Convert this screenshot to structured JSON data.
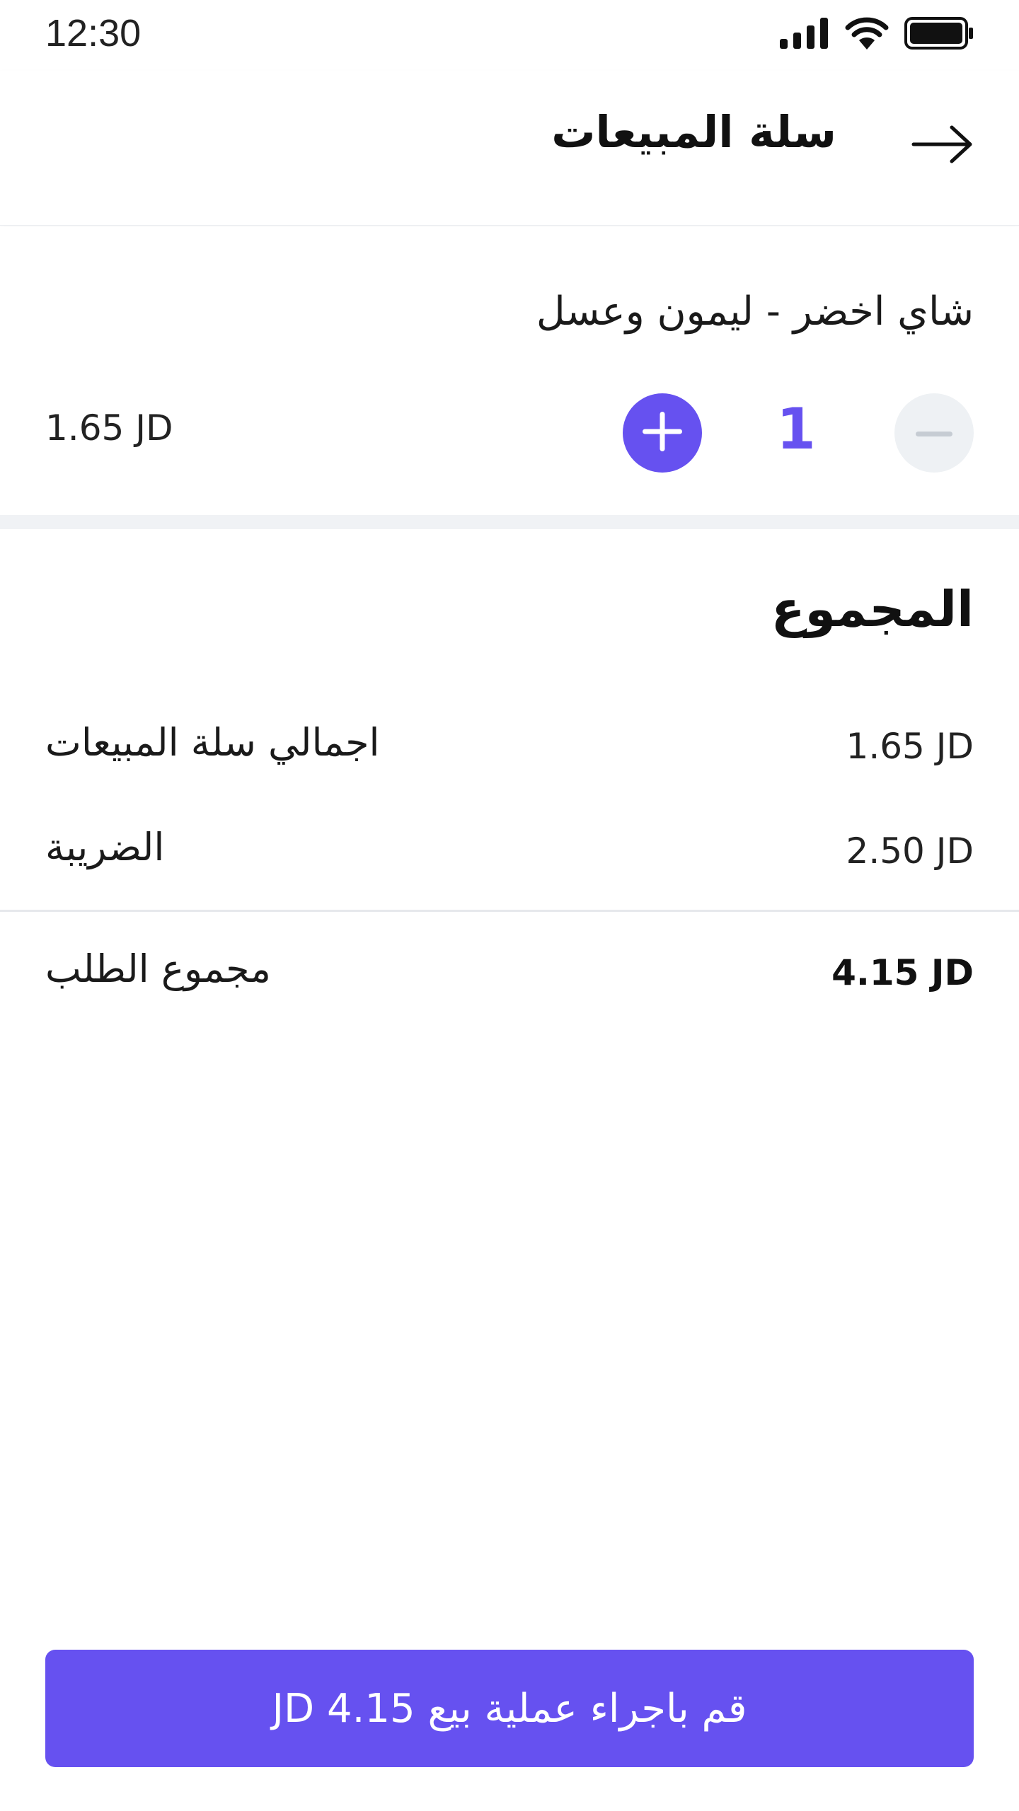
{
  "status_bar": {
    "time": "12:30",
    "icons": [
      "signal-icon",
      "wifi-icon",
      "battery-icon"
    ]
  },
  "header": {
    "title": "سلة المبيعات",
    "back_icon": "arrow-right-icon"
  },
  "cart_item": {
    "name": "شاي اخضر - ليمون وعسل",
    "price": "1.65 JD",
    "quantity": "1",
    "minus_icon": "minus-icon",
    "plus_icon": "plus-icon"
  },
  "totals": {
    "title": "المجموع",
    "subtotal_label": "اجمالي سلة المبيعات",
    "subtotal_value": "1.65 JD",
    "tax_label": "الضريبة",
    "tax_value": "2.50 JD",
    "order_total_label": "مجموع الطلب",
    "order_total_value": "4.15 JD"
  },
  "checkout": {
    "label": "قم باجراء عملية بيع 4.15 JD"
  },
  "colors": {
    "accent": "#6651f0",
    "minus_bg": "#eef1f4",
    "separator": "#f0f2f5"
  }
}
